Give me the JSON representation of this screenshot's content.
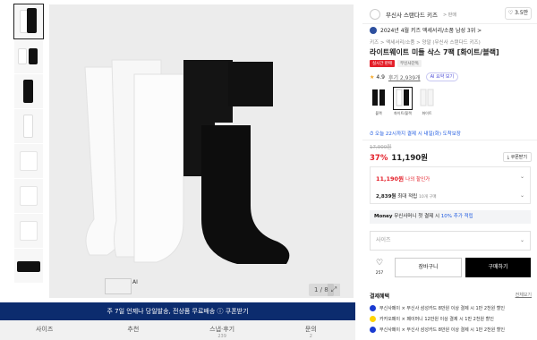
{
  "gallery": {
    "pager": "1 / 8",
    "mini_thumb_label": "AI"
  },
  "banner": {
    "text": "주 7일 언제나 당일발송, 전상품 무료배송 ⓘ 쿠폰받기"
  },
  "tabs": [
    {
      "label": "사이즈",
      "sub": ""
    },
    {
      "label": "추천",
      "sub": ""
    },
    {
      "label": "스냅·후기",
      "sub": "239"
    },
    {
      "label": "문의",
      "sub": "2"
    }
  ],
  "product": {
    "brand": "무신사 스탠다드 키즈",
    "brand_sub": "> 판매",
    "likes": "♡ 3.5만",
    "rank": "2024년 4월 키즈 액세서리/소품 남성 3위 >",
    "breadcrumb": "키즈 > 액세서리/소품 > 양말 (무신사 스탠다드 키즈)",
    "title": "라이트웨이트 미들 삭스 7팩 [화이트/블랙]",
    "badges": [
      "실시간 판매",
      "무신사단독"
    ],
    "rating": "4.9",
    "reviews": "후기 2,939개",
    "ai_chip": "AI 요약 보기",
    "options": [
      {
        "label": "블랙",
        "color": "#111111"
      },
      {
        "label": "화이트/블랙",
        "color": "#111111"
      },
      {
        "label": "화이트",
        "color": "#f0f0f0"
      }
    ],
    "delivery": "⏱ 오늘 22시까지 결제 시 내일(화) 도착보장",
    "original_price": "17,900원",
    "discount": "37%",
    "price": "11,190원",
    "coupon": "쿠폰받기"
  },
  "benefit": {
    "member_price": "11,190원",
    "member_label": "나의 할인가",
    "points": "2,839원",
    "points_label": "최대 적립",
    "points_note": "10개 구매",
    "chev": "⌄"
  },
  "money": {
    "prefix": "Money",
    "text": "무신사머니 첫 결제 시",
    "highlight": "10% 추가 적립"
  },
  "size_select": {
    "placeholder": "사이즈"
  },
  "actions": {
    "like_count": "257",
    "cart": "장바구니",
    "buy": "구매하기"
  },
  "payment": {
    "title": "결제혜택",
    "all": "전체보기",
    "rows": [
      {
        "text": "무신사페이 × 무신사 삼성카드 8만원 이상 결제 시 1만 2천원 할인",
        "color": "#1a3bd1"
      },
      {
        "text": "카카오페이 × 페이머니 12만원 이상 결제 시 1만 2천원 할인",
        "color": "#ffd400"
      },
      {
        "text": "무신사페이 × 무신사 삼성카드 8만원 이상 결제 시 1만 2천원 할인",
        "color": "#1a3bd1"
      }
    ]
  }
}
